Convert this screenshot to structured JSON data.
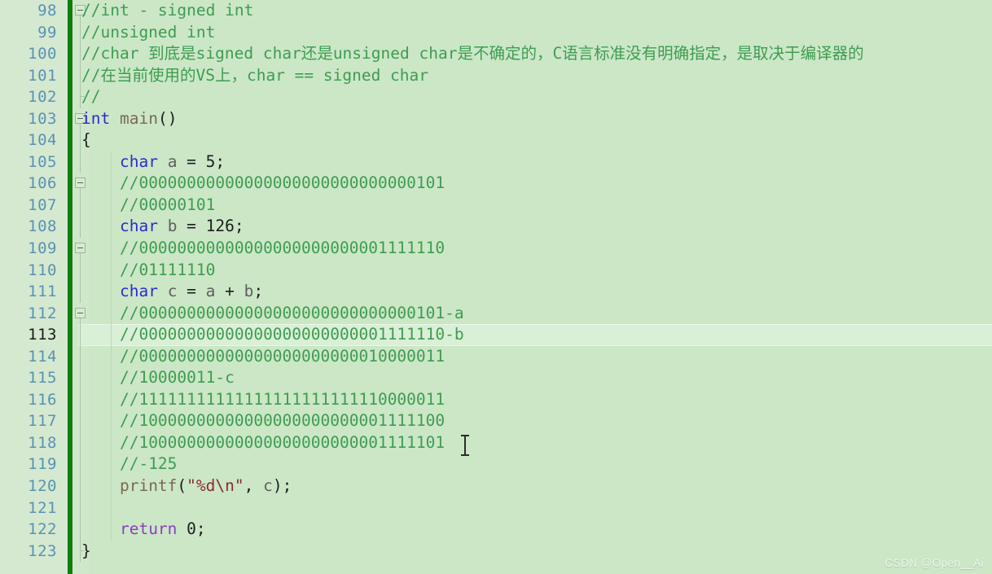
{
  "editor": {
    "colors": {
      "code_background": "#cbe7c6",
      "gutter_background": "#d5e9d0",
      "change_bar": "#117d11",
      "line_number": "#5a92b4",
      "current_line_number": "#1b1b1b",
      "current_line_background": "#d9efd6",
      "comment": "#3f9c52",
      "keyword": "#2b2bcd",
      "control_keyword": "#8b3fbf",
      "function": "#7a6a4f",
      "string": "#8a2b2b",
      "plain_text": "#1d1d1d"
    },
    "first_line_number": 98,
    "current_line_number": 113,
    "watermark": "CSDN @Open__Ai",
    "lines": [
      {
        "number": 98,
        "fold": "open",
        "indent_guide": false,
        "tokens": [
          {
            "t": "//int - signed int",
            "c": "t-cmt"
          }
        ]
      },
      {
        "number": 99,
        "fold": "line",
        "indent_guide": false,
        "tokens": [
          {
            "t": "//unsigned int",
            "c": "t-cmt"
          }
        ]
      },
      {
        "number": 100,
        "fold": "line",
        "indent_guide": false,
        "tokens": [
          {
            "t": "//char 到底是signed char还是unsigned char是不确定的，C语言标准没有明确指定，是取决于编译器的",
            "c": "t-cmt"
          }
        ]
      },
      {
        "number": 101,
        "fold": "line",
        "indent_guide": false,
        "tokens": [
          {
            "t": "//在当前使用的VS上，char == signed char",
            "c": "t-cmt"
          }
        ]
      },
      {
        "number": 102,
        "fold": "line-end",
        "indent_guide": false,
        "tokens": [
          {
            "t": "//",
            "c": "t-cmt"
          }
        ]
      },
      {
        "number": 103,
        "fold": "open",
        "indent_guide": false,
        "tokens": [
          {
            "t": "int",
            "c": "t-kw"
          },
          {
            "t": " ",
            "c": "t-plain"
          },
          {
            "t": "main",
            "c": "t-fn"
          },
          {
            "t": "()",
            "c": "t-punc"
          }
        ]
      },
      {
        "number": 104,
        "fold": "line",
        "indent_guide": false,
        "tokens": [
          {
            "t": "{",
            "c": "t-punc"
          }
        ]
      },
      {
        "number": 105,
        "fold": "line",
        "indent_guide": true,
        "tokens": [
          {
            "t": "    ",
            "c": "t-plain"
          },
          {
            "t": "char",
            "c": "t-kw"
          },
          {
            "t": " ",
            "c": "t-plain"
          },
          {
            "t": "a",
            "c": "t-var"
          },
          {
            "t": " = ",
            "c": "t-punc"
          },
          {
            "t": "5",
            "c": "t-num"
          },
          {
            "t": ";",
            "c": "t-punc"
          }
        ]
      },
      {
        "number": 106,
        "fold": "open",
        "indent_guide": true,
        "tokens": [
          {
            "t": "    ",
            "c": "t-plain"
          },
          {
            "t": "//00000000000000000000000000000101",
            "c": "t-cmt"
          }
        ]
      },
      {
        "number": 107,
        "fold": "line",
        "indent_guide": true,
        "tokens": [
          {
            "t": "    ",
            "c": "t-plain"
          },
          {
            "t": "//00000101",
            "c": "t-cmt"
          }
        ]
      },
      {
        "number": 108,
        "fold": "line",
        "indent_guide": true,
        "tokens": [
          {
            "t": "    ",
            "c": "t-plain"
          },
          {
            "t": "char",
            "c": "t-kw"
          },
          {
            "t": " ",
            "c": "t-plain"
          },
          {
            "t": "b",
            "c": "t-var"
          },
          {
            "t": " = ",
            "c": "t-punc"
          },
          {
            "t": "126",
            "c": "t-num"
          },
          {
            "t": ";",
            "c": "t-punc"
          }
        ]
      },
      {
        "number": 109,
        "fold": "open",
        "indent_guide": true,
        "tokens": [
          {
            "t": "    ",
            "c": "t-plain"
          },
          {
            "t": "//00000000000000000000000001111110",
            "c": "t-cmt"
          }
        ]
      },
      {
        "number": 110,
        "fold": "line",
        "indent_guide": true,
        "tokens": [
          {
            "t": "    ",
            "c": "t-plain"
          },
          {
            "t": "//01111110",
            "c": "t-cmt"
          }
        ]
      },
      {
        "number": 111,
        "fold": "line",
        "indent_guide": true,
        "tokens": [
          {
            "t": "    ",
            "c": "t-plain"
          },
          {
            "t": "char",
            "c": "t-kw"
          },
          {
            "t": " ",
            "c": "t-plain"
          },
          {
            "t": "c",
            "c": "t-var"
          },
          {
            "t": " = ",
            "c": "t-punc"
          },
          {
            "t": "a",
            "c": "t-var"
          },
          {
            "t": " + ",
            "c": "t-punc"
          },
          {
            "t": "b",
            "c": "t-var"
          },
          {
            "t": ";",
            "c": "t-punc"
          }
        ]
      },
      {
        "number": 112,
        "fold": "open",
        "indent_guide": true,
        "tokens": [
          {
            "t": "    ",
            "c": "t-plain"
          },
          {
            "t": "//00000000000000000000000000000101-a",
            "c": "t-cmt"
          }
        ]
      },
      {
        "number": 113,
        "fold": "line",
        "indent_guide": true,
        "current": true,
        "tokens": [
          {
            "t": "    ",
            "c": "t-plain"
          },
          {
            "t": "//00000000000000000000000001111110-b",
            "c": "t-cmt"
          }
        ]
      },
      {
        "number": 114,
        "fold": "line",
        "indent_guide": true,
        "tokens": [
          {
            "t": "    ",
            "c": "t-plain"
          },
          {
            "t": "//00000000000000000000000010000011",
            "c": "t-cmt"
          }
        ]
      },
      {
        "number": 115,
        "fold": "line",
        "indent_guide": true,
        "tokens": [
          {
            "t": "    ",
            "c": "t-plain"
          },
          {
            "t": "//10000011-c",
            "c": "t-cmt"
          }
        ]
      },
      {
        "number": 116,
        "fold": "line",
        "indent_guide": true,
        "tokens": [
          {
            "t": "    ",
            "c": "t-plain"
          },
          {
            "t": "//11111111111111111111111110000011",
            "c": "t-cmt"
          }
        ]
      },
      {
        "number": 117,
        "fold": "line",
        "indent_guide": true,
        "tokens": [
          {
            "t": "    ",
            "c": "t-plain"
          },
          {
            "t": "//10000000000000000000000001111100",
            "c": "t-cmt"
          }
        ]
      },
      {
        "number": 118,
        "fold": "line",
        "indent_guide": true,
        "tokens": [
          {
            "t": "    ",
            "c": "t-plain"
          },
          {
            "t": "//10000000000000000000000001111101",
            "c": "t-cmt"
          }
        ]
      },
      {
        "number": 119,
        "fold": "line",
        "indent_guide": true,
        "tokens": [
          {
            "t": "    ",
            "c": "t-plain"
          },
          {
            "t": "//-125",
            "c": "t-cmt"
          }
        ]
      },
      {
        "number": 120,
        "fold": "line",
        "indent_guide": true,
        "tokens": [
          {
            "t": "    ",
            "c": "t-plain"
          },
          {
            "t": "printf",
            "c": "t-fn"
          },
          {
            "t": "(",
            "c": "t-punc"
          },
          {
            "t": "\"%d\\n\"",
            "c": "t-str"
          },
          {
            "t": ", ",
            "c": "t-punc"
          },
          {
            "t": "c",
            "c": "t-var"
          },
          {
            "t": ");",
            "c": "t-punc"
          }
        ]
      },
      {
        "number": 121,
        "fold": "line",
        "indent_guide": true,
        "tokens": []
      },
      {
        "number": 122,
        "fold": "line",
        "indent_guide": true,
        "tokens": [
          {
            "t": "    ",
            "c": "t-plain"
          },
          {
            "t": "return",
            "c": "t-ctl"
          },
          {
            "t": " ",
            "c": "t-plain"
          },
          {
            "t": "0",
            "c": "t-num"
          },
          {
            "t": ";",
            "c": "t-punc"
          }
        ]
      },
      {
        "number": 123,
        "fold": "line-end",
        "indent_guide": false,
        "tokens": [
          {
            "t": "}",
            "c": "t-punc"
          }
        ]
      }
    ]
  }
}
